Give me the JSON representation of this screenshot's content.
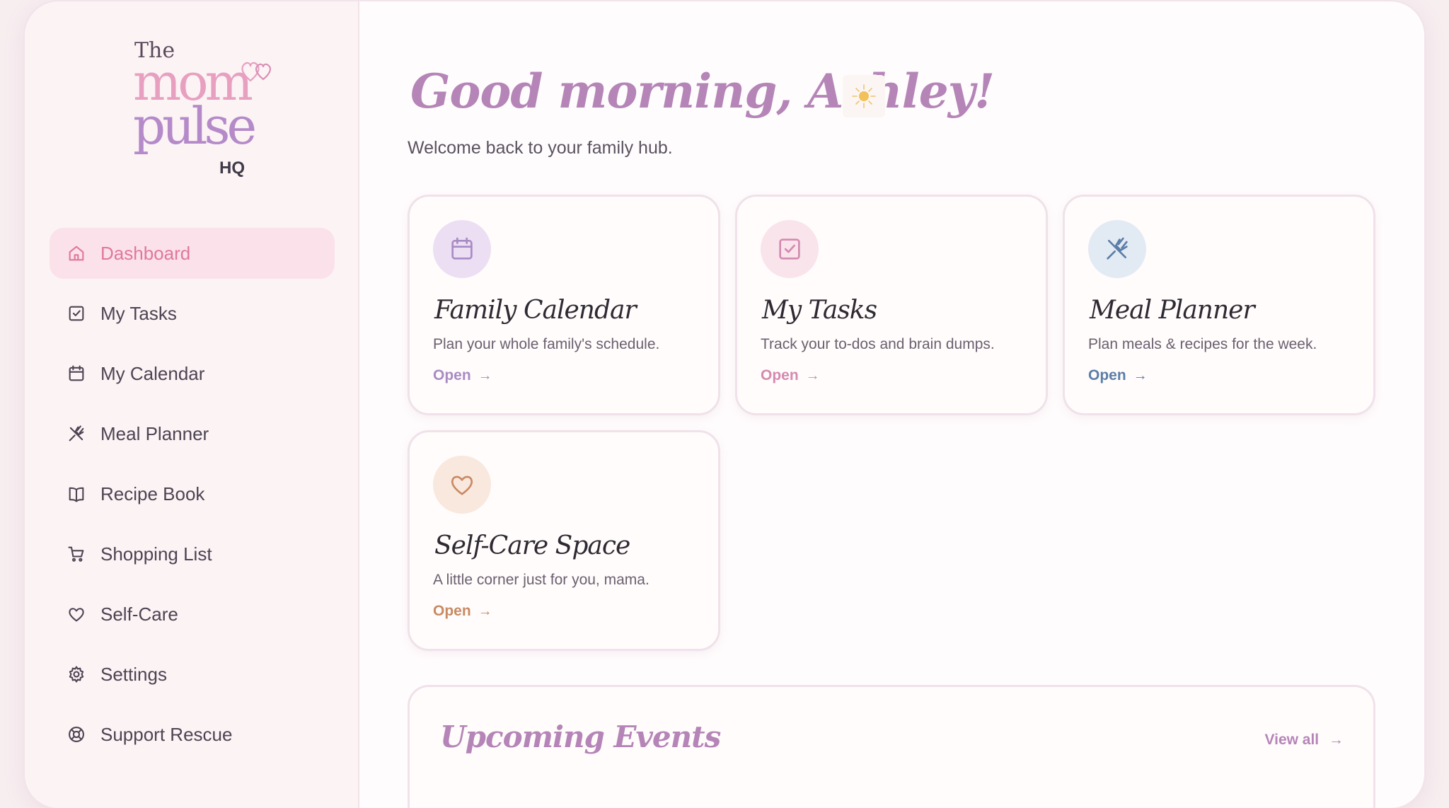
{
  "logo": {
    "the": "The",
    "mom": "mom",
    "pulse": "pulse",
    "hq": "HQ"
  },
  "sidebar": {
    "items": [
      {
        "label": "Dashboard",
        "icon": "home-icon",
        "active": true
      },
      {
        "label": "My Tasks",
        "icon": "check-square-icon"
      },
      {
        "label": "My Calendar",
        "icon": "calendar-icon"
      },
      {
        "label": "Meal Planner",
        "icon": "utensils-icon"
      },
      {
        "label": "Recipe Book",
        "icon": "book-icon"
      },
      {
        "label": "Shopping List",
        "icon": "cart-icon"
      },
      {
        "label": "Self-Care",
        "icon": "heart-icon"
      },
      {
        "label": "Settings",
        "icon": "gear-icon"
      },
      {
        "label": "Support Rescue",
        "icon": "lifebuoy-icon"
      }
    ]
  },
  "header": {
    "greeting": "Good morning, Ashley!",
    "greeting_icon": "sun-icon",
    "subtitle": "Welcome back to your family hub."
  },
  "cards": [
    {
      "title": "Family Calendar",
      "description": "Plan your whole family's schedule.",
      "link": "Open",
      "icon": "calendar-icon",
      "accent": "#a98bc4",
      "badge_bg": "#ecdff3"
    },
    {
      "title": "My Tasks",
      "description": "Track your to-dos and brain dumps.",
      "link": "Open",
      "icon": "check-square-icon",
      "accent": "#d58ab0",
      "badge_bg": "#f9e4ec"
    },
    {
      "title": "Meal Planner",
      "description": "Plan meals & recipes for the week.",
      "link": "Open",
      "icon": "utensils-icon",
      "accent": "#5c7ea8",
      "badge_bg": "#e2ebf3"
    },
    {
      "title": "Self-Care Space",
      "description": "A little corner just for you, mama.",
      "link": "Open",
      "icon": "heart-icon",
      "accent": "#c98a63",
      "badge_bg": "#f9e8de"
    }
  ],
  "events": {
    "title": "Upcoming Events",
    "view_all": "View all"
  },
  "colors": {
    "sidebar_bg": "#fcf3f5",
    "active_bg": "#fbe1ea",
    "active_text": "#e0789c",
    "heading": "#b585b8"
  }
}
